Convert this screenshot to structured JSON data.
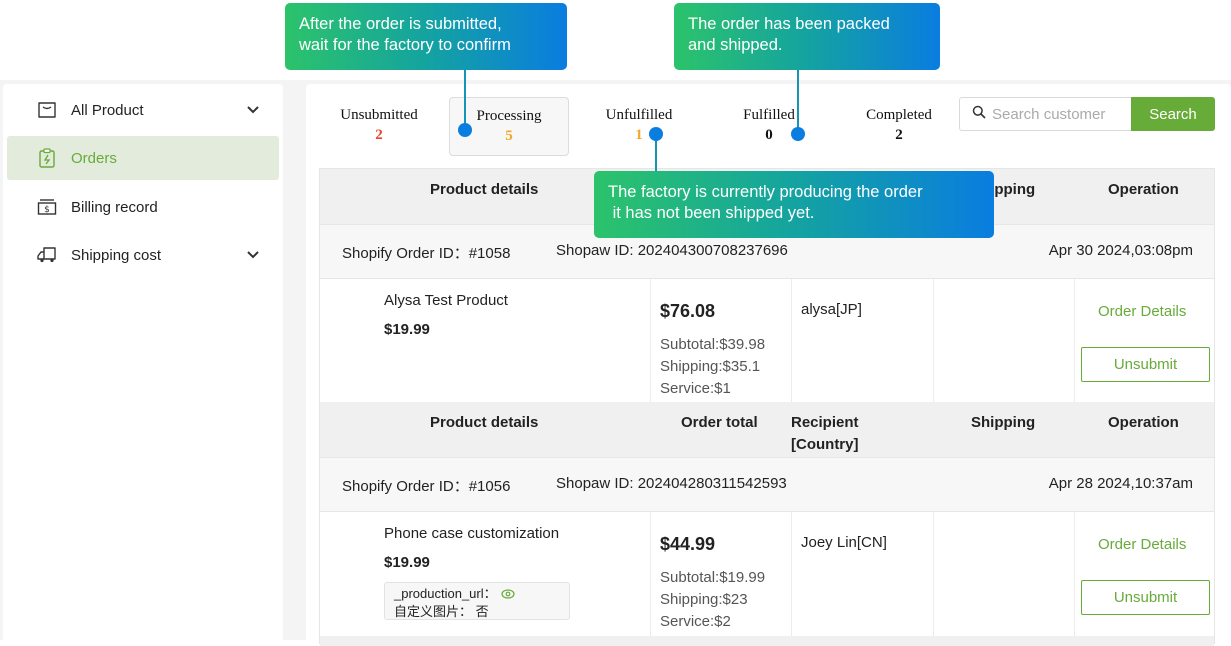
{
  "sidebar": {
    "items": [
      {
        "label": "All Product",
        "icon": "shopping-bag-icon",
        "has_chevron": true,
        "active": false
      },
      {
        "label": "Orders",
        "icon": "clipboard-bolt-icon",
        "has_chevron": false,
        "active": true
      },
      {
        "label": "Billing record",
        "icon": "dollar-bill-icon",
        "has_chevron": false,
        "active": false
      },
      {
        "label": "Shipping cost",
        "icon": "truck-icon",
        "has_chevron": true,
        "active": false
      }
    ]
  },
  "status_tabs": [
    {
      "label": "Unsubmitted",
      "count": "2",
      "count_color": "#e8452c"
    },
    {
      "label": "Processing",
      "count": "5",
      "count_color": "#f5a623",
      "active": true
    },
    {
      "label": "Unfulfilled",
      "count": "1",
      "count_color": "#f5a623"
    },
    {
      "label": "Fulfilled",
      "count": "0",
      "count_color": "#111111"
    },
    {
      "label": "Completed",
      "count": "2",
      "count_color": "#111111"
    }
  ],
  "search": {
    "placeholder": "Search customer",
    "value": "",
    "button_label": "Search"
  },
  "table": {
    "columns": [
      "Product details",
      "Order total",
      "Recipient\n[Country]",
      "Shipping",
      "Operation"
    ],
    "orders": [
      {
        "shopify_order_id": "Shopify Order ID：#1058",
        "shopaw_id": "Shopaw ID: 202404300708237696",
        "date": "Apr 30 2024,03:08pm",
        "product_name": "Alysa Test Product",
        "product_price": "$19.99",
        "properties": [],
        "total": "$76.08",
        "subtotal": "Subtotal:$39.98",
        "shipping": "Shipping:$35.1",
        "service": "Service:$1",
        "recipient": "alysa[JP]",
        "shipping_info": "",
        "details_label": "Order Details",
        "unsubmit_label": "Unsubmit"
      },
      {
        "shopify_order_id": "Shopify Order ID：#1056",
        "shopaw_id": "Shopaw ID: 202404280311542593",
        "date": "Apr 28 2024,10:37am",
        "product_name": "Phone case customization",
        "product_price": "$19.99",
        "properties": [
          "_production_url：",
          "自定义图片： 否"
        ],
        "total": "$44.99",
        "subtotal": "Subtotal:$19.99",
        "shipping": "Shipping:$23",
        "service": "Service:$2",
        "recipient": "Joey Lin[CN]",
        "shipping_info": "",
        "details_label": "Order Details",
        "unsubmit_label": "Unsubmit"
      }
    ]
  },
  "callouts": {
    "processing": "After the order is submitted,\nwait for the factory to confirm",
    "fulfilled": "The order has been packed\nand shipped.",
    "unfulfilled": "The factory is currently producing the order\n it has not been shipped yet."
  },
  "colors": {
    "accent": "#67ab39",
    "active_bg": "#e3ebdc",
    "callout_start": "#2cc36b",
    "callout_end": "#0a7de0"
  }
}
